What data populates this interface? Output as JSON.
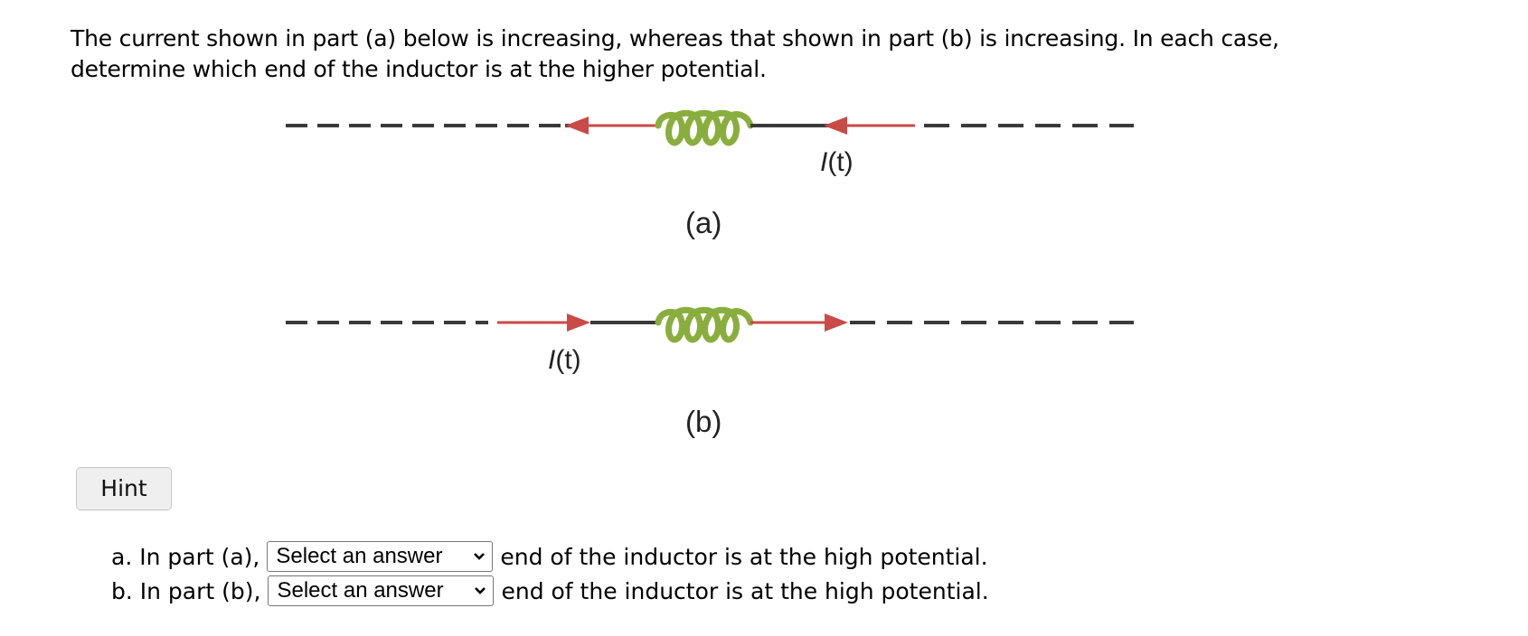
{
  "question": {
    "text": "The current shown in part (a) below is increasing, whereas that shown in part (b) is increasing. In each case, determine which end of the inductor is at the higher potential."
  },
  "figure": {
    "part_a": {
      "label": "(a)",
      "current_label_var": "I",
      "current_label_arg": "(t)",
      "current_direction": "left"
    },
    "part_b": {
      "label": "(b)",
      "current_label_var": "I",
      "current_label_arg": "(t)",
      "current_direction": "right"
    },
    "colors": {
      "wire": "#3a3a3a",
      "current": "#c94a47",
      "inductor": "#8aae3e"
    }
  },
  "hint": {
    "label": "Hint"
  },
  "answers": [
    {
      "prefix": "a. In part (a),",
      "select_value": "Select an answer",
      "suffix": "end of the inductor is at the high potential."
    },
    {
      "prefix": "b. In part (b),",
      "select_value": "Select an answer",
      "suffix": "end of the inductor is at the high potential."
    }
  ]
}
